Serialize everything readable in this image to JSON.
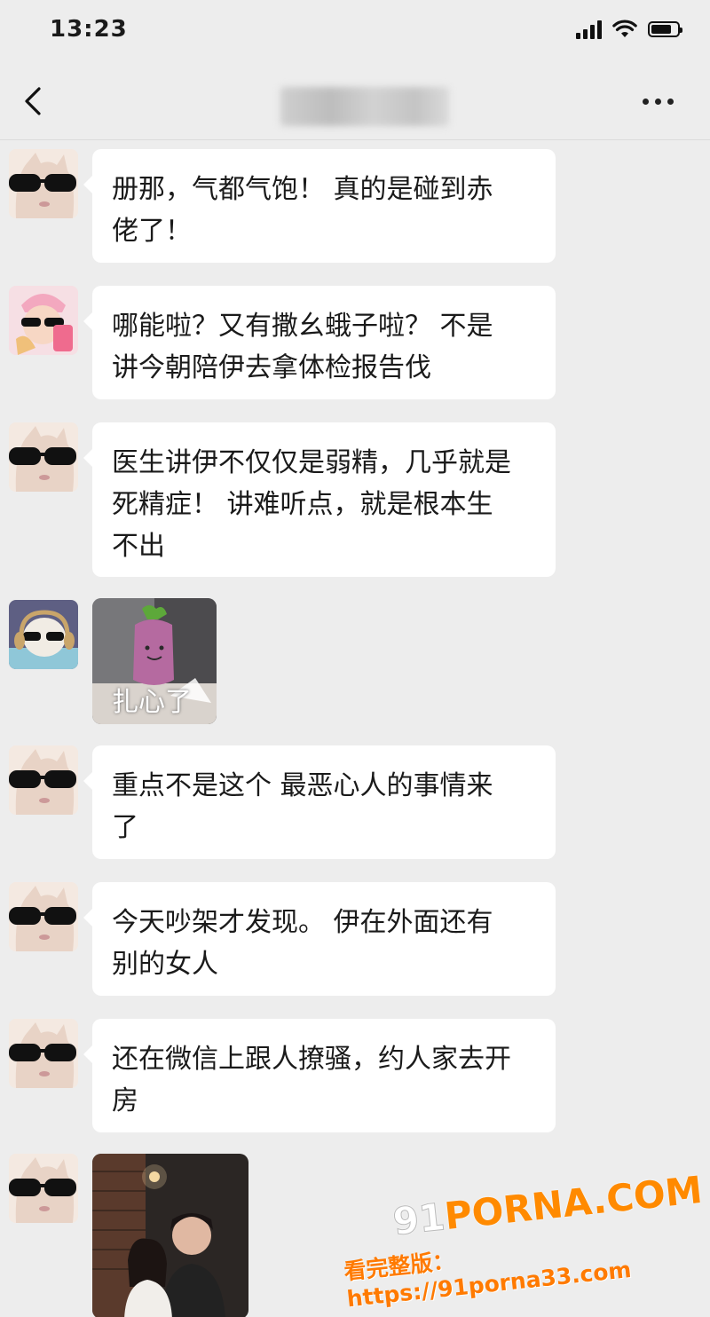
{
  "status_bar": {
    "time": "13:23",
    "battery_level": 0.8
  },
  "nav": {
    "title_obscured": true
  },
  "messages": [
    {
      "type": "text",
      "avatar": "cat-sunglasses",
      "lines": [
        "册那，气都气饱！ 真的是碰到赤",
        "佬了！"
      ]
    },
    {
      "type": "text",
      "avatar": "girl-pink-hat",
      "lines": [
        "哪能啦？又有撒幺蛾子啦？ 不是",
        "讲今朝陪伊去拿体检报告伐"
      ]
    },
    {
      "type": "text",
      "avatar": "cat-sunglasses",
      "lines": [
        "医生讲伊不仅仅是弱精，几乎就是",
        "死精症！ 讲难听点，就是根本生",
        "不出"
      ]
    },
    {
      "type": "sticker",
      "avatar": "dog-headphones",
      "caption": "扎心了"
    },
    {
      "type": "text",
      "avatar": "cat-sunglasses",
      "lines": [
        "重点不是这个 最恶心人的事情来",
        "了"
      ]
    },
    {
      "type": "text",
      "avatar": "cat-sunglasses",
      "lines": [
        "今天吵架才发现。 伊在外面还有",
        "别的女人"
      ]
    },
    {
      "type": "text",
      "avatar": "cat-sunglasses",
      "lines": [
        "还在微信上跟人撩骚，约人家去开",
        "房"
      ]
    },
    {
      "type": "photo",
      "avatar": "cat-sunglasses",
      "description_hidden": true
    }
  ],
  "watermark": {
    "logo_prefix": "91",
    "logo_main": "PORNA.COM",
    "url_text": "看完整版：https://91porna33.com"
  },
  "colors": {
    "background": "#ededed",
    "bubble": "#ffffff",
    "watermark": "#ff8a00"
  }
}
